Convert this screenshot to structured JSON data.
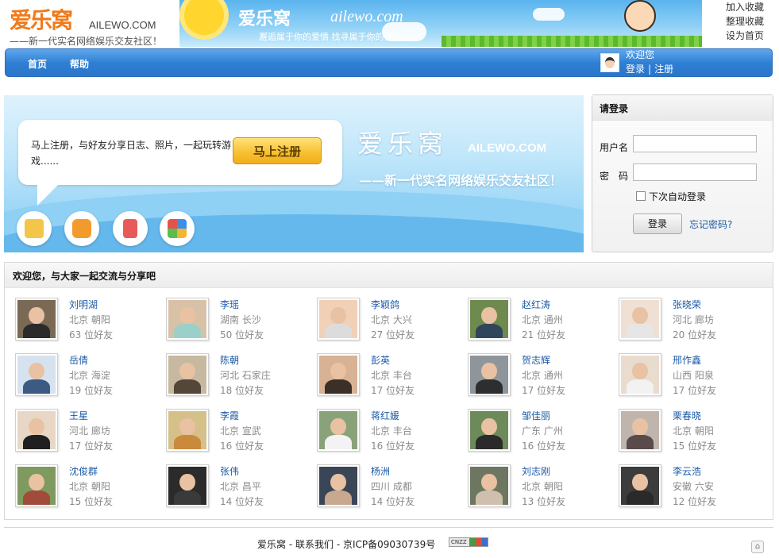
{
  "header": {
    "logo_cn": "爱乐窝",
    "logo_en": "AILEWO.COM",
    "logo_tagline": "——新一代实名网络娱乐交友社区！",
    "banner_title": "爱乐窝",
    "banner_site": "ailewo.com",
    "banner_slogan": "邂逅属于你的爱情  找寻属于你的快乐......",
    "top_links": [
      "加入收藏",
      "整理收藏",
      "设为首页"
    ]
  },
  "nav": {
    "items": [
      "首页",
      "帮助"
    ],
    "welcome": "欢迎您",
    "login": "登录",
    "separator": "|",
    "register": "注册"
  },
  "hero": {
    "bubble_text": "马上注册，与好友分享日志、照片，一起玩转游戏......",
    "register_button": "马上注册",
    "brand": "爱乐窝",
    "brand_en": "AILEWO.COM",
    "brand_tagline": "——新一代实名网络娱乐交友社区！",
    "icons": [
      "message-icon",
      "camera-icon",
      "card-icon",
      "apps-icon"
    ]
  },
  "login": {
    "title": "请登录",
    "username_label": "用户名",
    "password_label": "密　码",
    "remember_label": "下次自动登录",
    "submit": "登录",
    "forgot": "忘记密码?"
  },
  "members": {
    "title": "欢迎您，与大家一起交流与分享吧",
    "list": [
      {
        "name": "刘明湖",
        "location": "北京 朝阳",
        "friends": "63 位好友"
      },
      {
        "name": "李瑶",
        "location": "湖南 长沙",
        "friends": "50 位好友"
      },
      {
        "name": "李颖鸽",
        "location": "北京 大兴",
        "friends": "27 位好友"
      },
      {
        "name": "赵红涛",
        "location": "北京 通州",
        "friends": "21 位好友"
      },
      {
        "name": "张晓荣",
        "location": "河北 廊坊",
        "friends": "20 位好友"
      },
      {
        "name": "岳倩",
        "location": "北京 海淀",
        "friends": "19 位好友"
      },
      {
        "name": "陈朝",
        "location": "河北 石家庄",
        "friends": "18 位好友"
      },
      {
        "name": "彭英",
        "location": "北京 丰台",
        "friends": "17 位好友"
      },
      {
        "name": "贺志辉",
        "location": "北京 通州",
        "friends": "17 位好友"
      },
      {
        "name": "邢作鑫",
        "location": "山西 阳泉",
        "friends": "17 位好友"
      },
      {
        "name": "王星",
        "location": "河北 廊坊",
        "friends": "17 位好友"
      },
      {
        "name": "李霞",
        "location": "北京 宣武",
        "friends": "16 位好友"
      },
      {
        "name": "蒋红媛",
        "location": "北京 丰台",
        "friends": "16 位好友"
      },
      {
        "name": "邹佳丽",
        "location": "广东 广州",
        "friends": "16 位好友"
      },
      {
        "name": "栗春晓",
        "location": "北京 朝阳",
        "friends": "15 位好友"
      },
      {
        "name": "沈俊群",
        "location": "北京 朝阳",
        "friends": "15 位好友"
      },
      {
        "name": "张伟",
        "location": "北京 昌平",
        "friends": "14 位好友"
      },
      {
        "name": "杨洲",
        "location": "四川 成都",
        "friends": "14 位好友"
      },
      {
        "name": "刘志刚",
        "location": "北京 朝阳",
        "friends": "13 位好友"
      },
      {
        "name": "李云浩",
        "location": "安徽 六安",
        "friends": "12 位好友"
      }
    ]
  },
  "footer": {
    "site": "爱乐窝",
    "sep1": " - ",
    "contact": "联系我们",
    "sep2": " - ",
    "icp": "京ICP备09030739号",
    "counter_badge": "CNZZ",
    "to_top_icon": "home-icon"
  },
  "colors": {
    "nav_blue": "#2f7fd4",
    "link_blue": "#1c5aa6",
    "button_gold": "#f7bf2f",
    "logo_orange": "#f07a1a"
  }
}
